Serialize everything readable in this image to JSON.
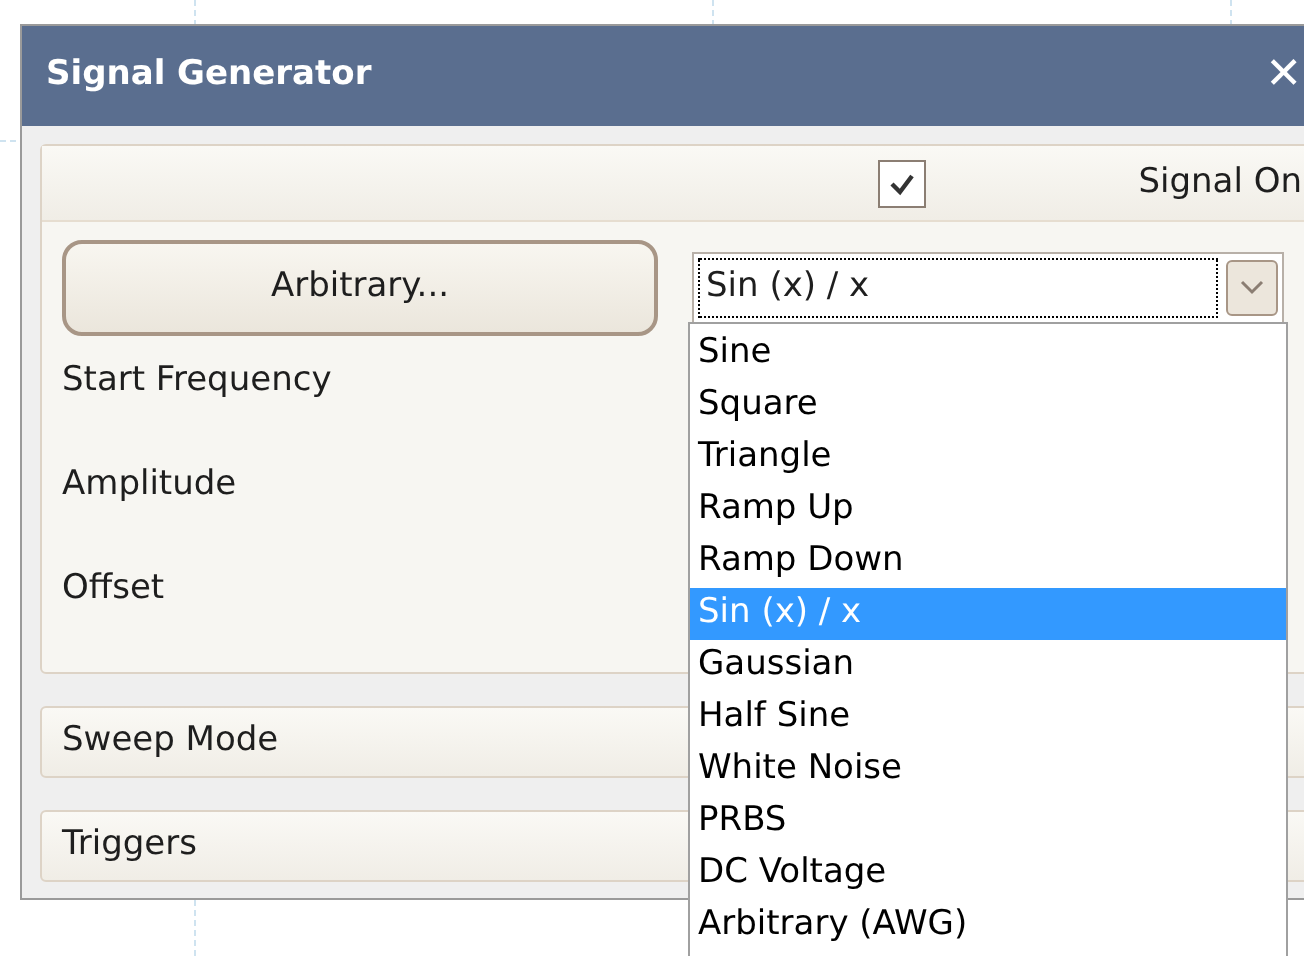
{
  "window": {
    "title": "Signal Generator",
    "close": "✕"
  },
  "signal_on": {
    "label": "Signal On",
    "checked": true
  },
  "arbitrary_button": {
    "label": "Arbitrary..."
  },
  "waveform": {
    "value": "Sin (x) / x",
    "expanded": true,
    "options": [
      {
        "label": "Sine",
        "selected": false
      },
      {
        "label": "Square",
        "selected": false
      },
      {
        "label": "Triangle",
        "selected": false
      },
      {
        "label": "Ramp Up",
        "selected": false
      },
      {
        "label": "Ramp Down",
        "selected": false
      },
      {
        "label": "Sin (x) / x",
        "selected": true
      },
      {
        "label": "Gaussian",
        "selected": false
      },
      {
        "label": "Half Sine",
        "selected": false
      },
      {
        "label": "White Noise",
        "selected": false
      },
      {
        "label": "PRBS",
        "selected": false
      },
      {
        "label": "DC Voltage",
        "selected": false
      },
      {
        "label": "Arbitrary (AWG)",
        "selected": false
      }
    ]
  },
  "fields": [
    "Start Frequency",
    "Amplitude",
    "Offset"
  ],
  "sections": [
    "Sweep Mode",
    "Triggers"
  ]
}
